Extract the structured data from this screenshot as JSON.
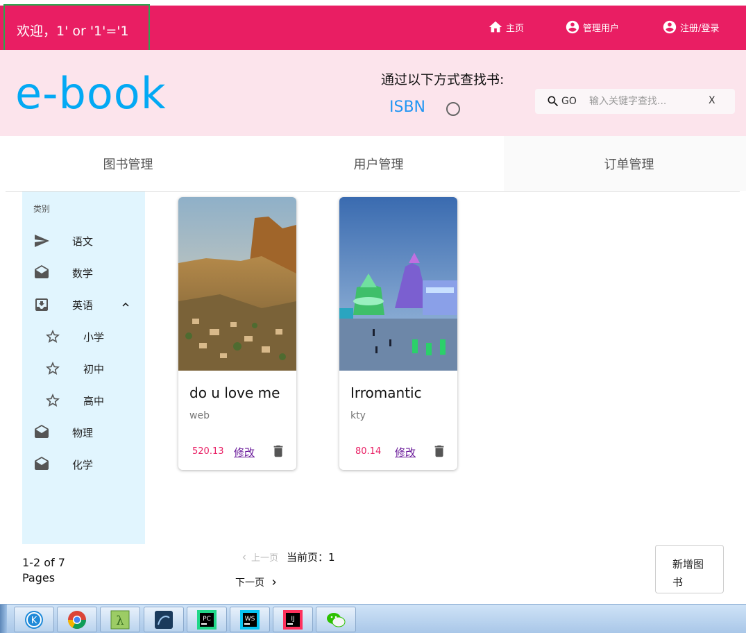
{
  "topbar": {
    "welcome": "欢迎，1' or '1'='1",
    "nav": [
      {
        "label": "主页",
        "icon": "home-icon"
      },
      {
        "label": "管理用户",
        "icon": "account-circle-icon"
      },
      {
        "label": "注册/登录",
        "icon": "account-circle-icon"
      }
    ]
  },
  "header": {
    "logo": "e-book",
    "search_title": "通过以下方式查找书:",
    "search_mode": "ISBN",
    "search_button": "GO",
    "search_placeholder": "输入关键字查找...",
    "clear_label": "X"
  },
  "tabs": [
    {
      "label": "图书管理"
    },
    {
      "label": "用户管理"
    },
    {
      "label": "订单管理",
      "active": true
    }
  ],
  "sidebar": {
    "header": "类别",
    "items": [
      {
        "label": "语文",
        "icon": "send-icon"
      },
      {
        "label": "数学",
        "icon": "drafts-icon"
      },
      {
        "label": "英语",
        "icon": "move-to-inbox-icon",
        "expanded": true
      },
      {
        "label": "小学",
        "icon": "star-outline-icon"
      },
      {
        "label": "初中",
        "icon": "star-outline-icon"
      },
      {
        "label": "高中",
        "icon": "star-outline-icon"
      },
      {
        "label": "物理",
        "icon": "drafts-icon"
      },
      {
        "label": "化学",
        "icon": "drafts-icon"
      }
    ]
  },
  "books": [
    {
      "title": "do u love me",
      "author": "web",
      "price": "520.13",
      "edit_label": "修改",
      "image": "desert-town-photo"
    },
    {
      "title": "Irromantic",
      "author": "kty",
      "price": "80.14",
      "edit_label": "修改",
      "image": "ice-festival-photo"
    }
  ],
  "pagination": {
    "pages_info": "1-2 of 7 Pages",
    "prev_label": "上一页",
    "current_label": "当前页：1",
    "next_label": "下一页"
  },
  "add_book_label": "新增图书",
  "taskbar": {
    "apps": [
      "kodi-icon",
      "chrome-icon",
      "lambda-icon",
      "mysql-workbench-icon",
      "pycharm-icon",
      "webstorm-icon",
      "intellij-icon",
      "wechat-icon"
    ]
  },
  "colors": {
    "topbar": "#e91e63",
    "header_bg": "#fce4ec",
    "logo": "#03a9f4",
    "sidebar_bg": "#e1f5fe",
    "price": "#e91e63"
  }
}
